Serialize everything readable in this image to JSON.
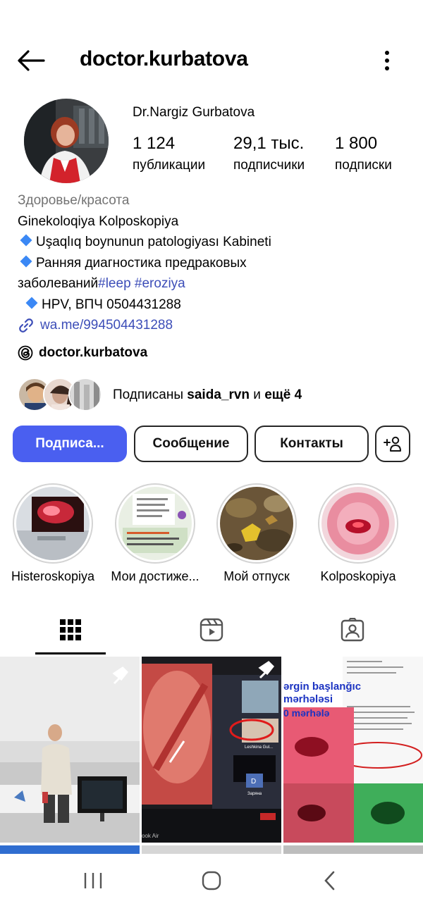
{
  "header": {
    "username": "doctor.kurbatova",
    "back_icon": "arrow-left-icon",
    "menu_icon": "more-vertical-icon"
  },
  "profile": {
    "full_name": "Dr.Nargiz Gurbatova",
    "stats": [
      {
        "value": "1 124",
        "label": "публикации"
      },
      {
        "value": "29,1 тыс.",
        "label": "подписчики"
      },
      {
        "value": "1 800",
        "label": "подписки"
      }
    ]
  },
  "bio": {
    "category": "Здоровье/красота",
    "line1": "Ginekoloqiya Kolposkopiya",
    "line2": "Uşaqlıq boynunun patologiyası Kabineti",
    "line3": "Ранняя диагностика предраковых",
    "line4_text": "заболеваний",
    "tag1": "#leep",
    "tag2": "#eroziya",
    "line5": "HPV, ВПЧ 0504431288",
    "link": "wa.me/994504431288"
  },
  "threads": {
    "handle": "doctor.kurbatova"
  },
  "followed_by": {
    "prefix": "Подписаны ",
    "user": "saida_rvn",
    "middle": " и ",
    "rest": "ещё 4"
  },
  "buttons": {
    "subscribe": "Подписа...",
    "message": "Сообщение",
    "contacts": "Контакты",
    "add_person_icon": "add-person-icon"
  },
  "highlights": [
    {
      "label": "Histeroskopiya"
    },
    {
      "label": "Мои достиже..."
    },
    {
      "label": "Мой отпуск"
    },
    {
      "label": "Kolposkopiya"
    }
  ],
  "tabs": [
    {
      "icon": "grid-icon"
    },
    {
      "icon": "reels-icon"
    },
    {
      "icon": "tagged-icon"
    }
  ],
  "posts": {
    "post2": {
      "caption": "Leshkina Gul...",
      "tile": "D",
      "tile_label": "Заряна",
      "footer": "ook Air"
    },
    "post3": {
      "title1": "ərgin başlanğıc",
      "title2": "mərhələsi",
      "title3": "0 mərhələ"
    }
  },
  "colors": {
    "primary": "#4a5ff0",
    "link": "#3d4eb8",
    "muted": "#737373",
    "diamond": "#3b88f5"
  }
}
